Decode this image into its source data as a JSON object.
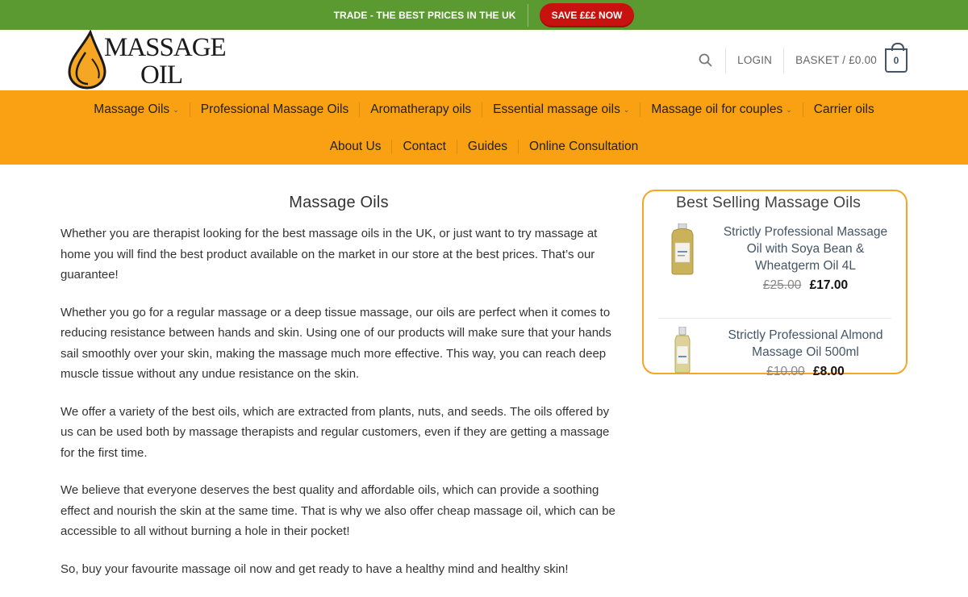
{
  "topbar": {
    "text": "TRADE - THE BEST PRICES IN THE UK",
    "button": "SAVE £££ NOW",
    "bg_color": "#5b9a31",
    "button_color": "#c8120f"
  },
  "header": {
    "logo_line1": "MASSAGE",
    "logo_line2": "OIL",
    "search_icon": "search-icon",
    "login": "LOGIN",
    "basket": "BASKET / £0.00",
    "cart_count": "0"
  },
  "nav": {
    "bg_color": "#f9a113",
    "row1": [
      {
        "label": "Massage Oils",
        "dropdown": true
      },
      {
        "label": "Professional Massage Oils",
        "dropdown": false
      },
      {
        "label": "Aromatherapy oils",
        "dropdown": false
      },
      {
        "label": "Essential massage oils",
        "dropdown": true
      },
      {
        "label": "Massage oil for couples",
        "dropdown": true
      },
      {
        "label": "Carrier oils",
        "dropdown": false
      }
    ],
    "row2": [
      {
        "label": "About Us"
      },
      {
        "label": "Contact"
      },
      {
        "label": "Guides"
      },
      {
        "label": "Online Consultation"
      }
    ]
  },
  "main": {
    "title": "Massage Oils",
    "paragraphs": [
      "Whether you are therapist looking for the best massage oils in the UK, or just want to try massage at home you will find the best product available on the market in our store at the best prices. That’s our guarantee!",
      "Whether you go for a regular massage or a deep tissue massage, our oils are perfect when it comes to reducing resistance between hands and skin. Using one of our products will make sure that your hands sail smoothly over your skin, making the massage much more effective. This way, you can reach deep muscle tissue without any undue resistance on the skin.",
      "We offer a variety of the best oils, which are extracted from plants, nuts, and seeds. The oils offered by us can be used both by massage therapists and regular customers, even if they are getting a massage for the first time.",
      "We believe that everyone deserves the best quality and affordable oils, which can provide a soothing effect and nourish the skin at the same time. That is why we also offer cheap massage oil, which can be accessible to all without burning a hole in their pocket!",
      "So, buy your favourite massage oil now and get ready to have a healthy mind and healthy skin!"
    ]
  },
  "sidebar": {
    "title": "Best Selling Massage Oils",
    "border_color": "#f5a623",
    "products": [
      {
        "name": "Strictly Professional Massage Oil with Soya Bean & Wheatgerm Oil 4L",
        "old_price": "£25.00",
        "new_price": "£17.00"
      },
      {
        "name": "Strictly Professional Almond Massage Oil 500ml",
        "old_price": "£10.00",
        "new_price": "£8.00"
      }
    ]
  }
}
